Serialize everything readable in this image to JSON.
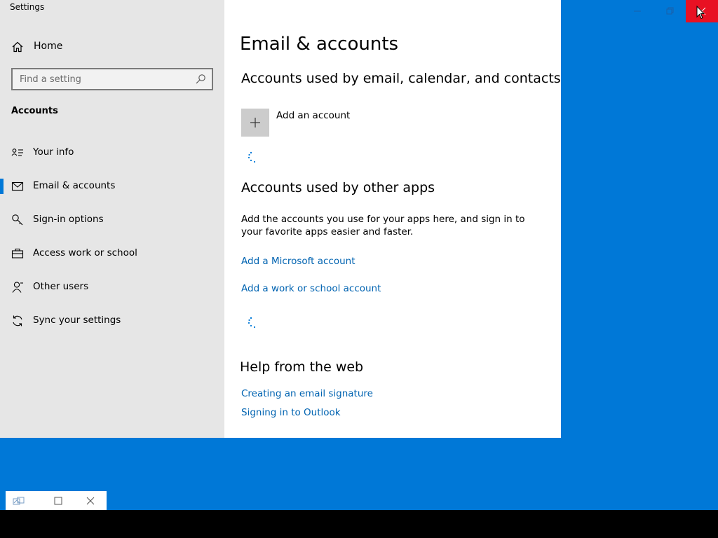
{
  "app": {
    "title": "Settings"
  },
  "sidebar": {
    "home_label": "Home",
    "search_placeholder": "Find a setting",
    "section_heading": "Accounts",
    "items": [
      {
        "label": "Your info",
        "icon": "contact-card-icon",
        "selected": false
      },
      {
        "label": "Email & accounts",
        "icon": "mail-icon",
        "selected": true
      },
      {
        "label": "Sign-in options",
        "icon": "key-icon",
        "selected": false
      },
      {
        "label": "Access work or school",
        "icon": "briefcase-icon",
        "selected": false
      },
      {
        "label": "Other users",
        "icon": "person-icon",
        "selected": false
      },
      {
        "label": "Sync your settings",
        "icon": "sync-icon",
        "selected": false
      }
    ]
  },
  "main": {
    "page_title": "Email & accounts",
    "email_section": {
      "heading": "Accounts used by email, calendar, and contacts",
      "add_account_label": "Add an account"
    },
    "apps_section": {
      "heading": "Accounts used by other apps",
      "description": "Add the accounts you use for your apps here, and sign in to your favorite apps easier and faster.",
      "links": [
        "Add a Microsoft account",
        "Add a work or school account"
      ]
    },
    "help_section": {
      "heading": "Help from the web",
      "links": [
        "Creating an email signature",
        "Signing in to Outlook"
      ]
    }
  },
  "colors": {
    "accent": "#0078d7",
    "link": "#0063b1",
    "close_hover": "#e81123",
    "sidebar_bg": "#e6e6e6"
  }
}
